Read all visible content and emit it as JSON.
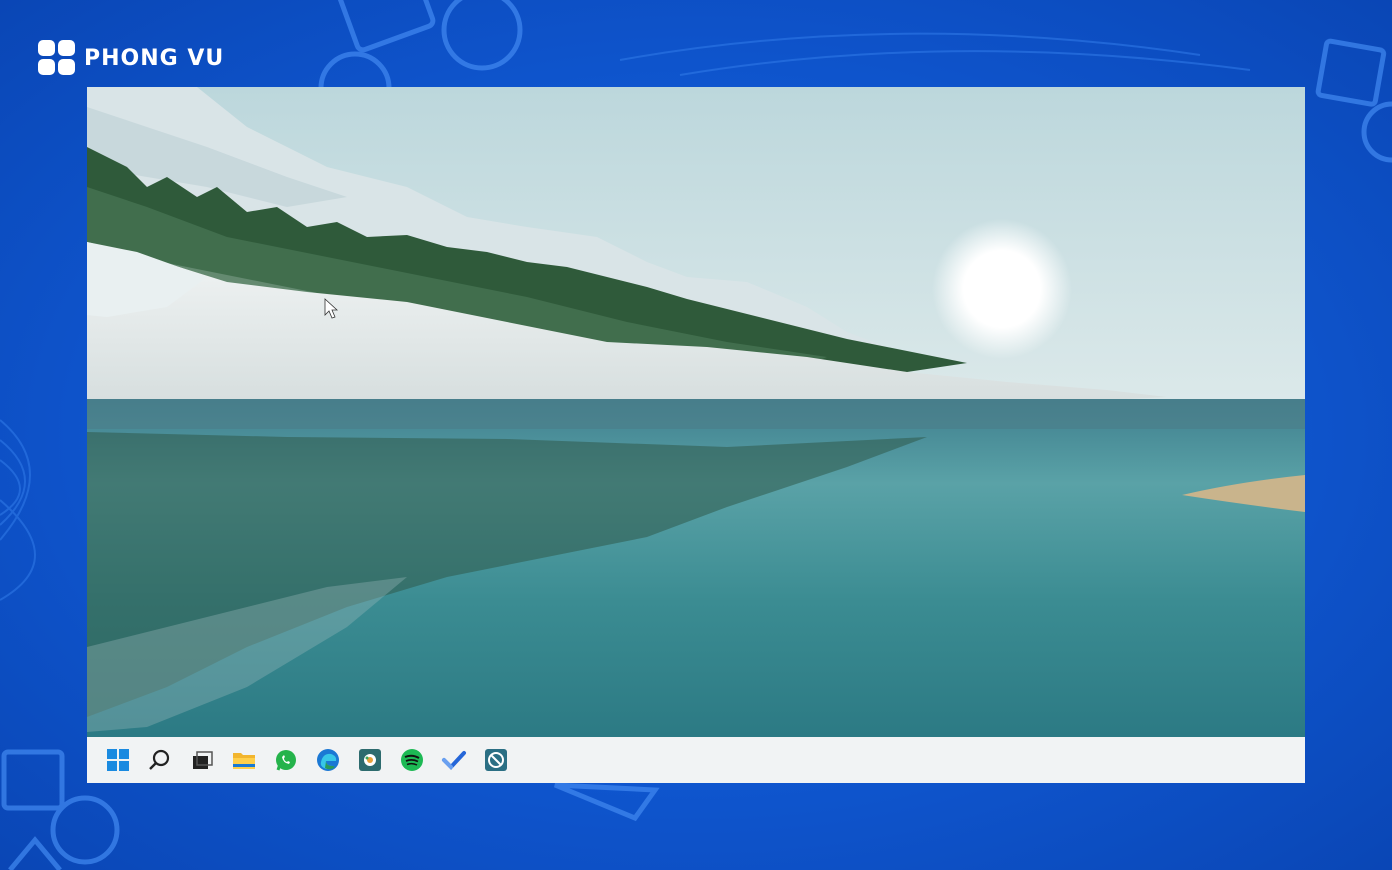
{
  "brand": {
    "name": "PHONG VU",
    "color": "#ffffff"
  },
  "background": {
    "color": "#1262dc"
  },
  "desktop": {
    "wallpaper": "mountain-lake-sunrise"
  },
  "taskbar": {
    "color": "#f1f3f4",
    "items": [
      {
        "icon": "windows-start-icon"
      },
      {
        "icon": "search-icon"
      },
      {
        "icon": "task-view-icon"
      },
      {
        "icon": "file-explorer-icon"
      },
      {
        "icon": "whatsapp-icon"
      },
      {
        "icon": "edge-icon"
      },
      {
        "icon": "app-settings-icon"
      },
      {
        "icon": "spotify-icon"
      },
      {
        "icon": "todo-icon"
      },
      {
        "icon": "blocked-app-icon"
      }
    ]
  }
}
